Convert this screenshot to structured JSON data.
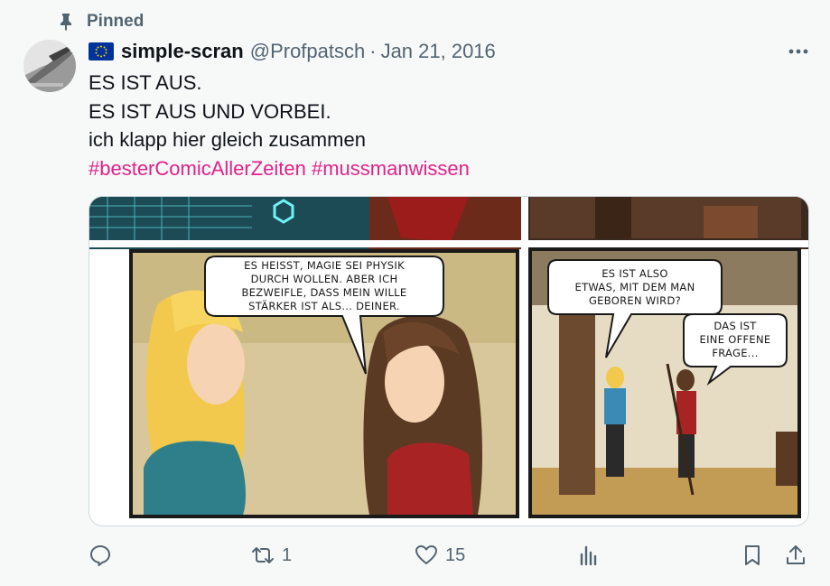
{
  "pinned_label": "Pinned",
  "author": {
    "display_name": "simple-scran",
    "handle": "@Profpatsch",
    "separator": "·",
    "date": "Jan 21, 2016",
    "flag_icon": "eu-flag-icon",
    "flag_color": "#003399"
  },
  "tweet": {
    "lines": [
      "ES IST AUS.",
      "ES IST AUS UND VORBEI.",
      "ich klapp hier gleich zusammen"
    ],
    "hashtags": [
      "#besterComicAllerZeiten",
      "#mussmanwissen"
    ],
    "hashtag_color": "#e0218a"
  },
  "comic": {
    "bubble_left": [
      "ES HEISST, MAGIE SEI PHYSIK",
      "DURCH WOLLEN. ABER ICH",
      "BEZWEIFLE, DASS MEIN WILLE",
      "STÄRKER IST ALS... DEINER."
    ],
    "bubble_right_top": [
      "ES IST ALSO",
      "ETWAS, MIT DEM MAN",
      "GEBOREN WIRD?"
    ],
    "bubble_right_bottom": [
      "DAS IST",
      "EINE OFFENE",
      "FRAGE..."
    ]
  },
  "actions": {
    "reply": {
      "icon": "reply-icon",
      "count": ""
    },
    "retweet": {
      "icon": "retweet-icon",
      "count": "1"
    },
    "like": {
      "icon": "heart-icon",
      "count": "15"
    },
    "views": {
      "icon": "analytics-icon",
      "count": ""
    },
    "bookmark": {
      "icon": "bookmark-icon"
    },
    "share": {
      "icon": "share-icon"
    }
  },
  "colors": {
    "text": "#0f1419",
    "secondary": "#536471",
    "background": "#f7f9f9"
  }
}
